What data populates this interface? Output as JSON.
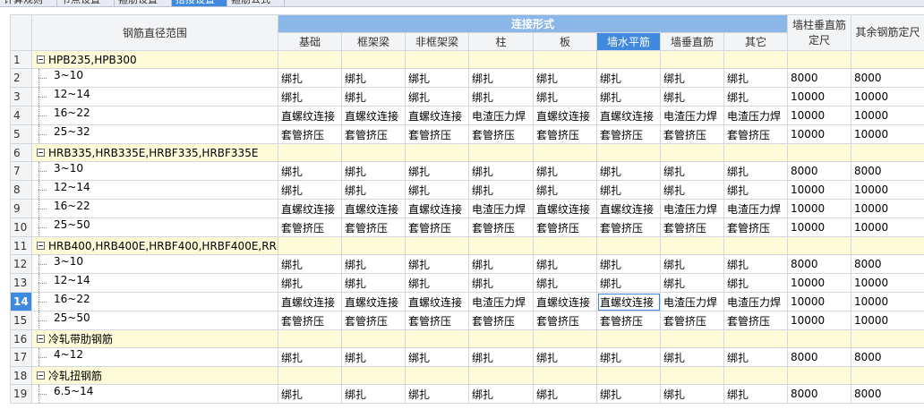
{
  "tabs": [
    {
      "label": "计算规则"
    },
    {
      "label": "节点设置"
    },
    {
      "label": "箍筋设置"
    },
    {
      "label": "搭接设置"
    },
    {
      "label": "箍筋公式"
    }
  ],
  "header": {
    "diameter": "钢筋直径范围",
    "connection_group": "连接形式",
    "columns": [
      "基础",
      "框架梁",
      "非框架梁",
      "柱",
      "板",
      "墙水平筋",
      "墙垂直筋",
      "其它"
    ],
    "wall_col_length": "墙柱垂直筋定尺",
    "other_length": "其余钢筋定尺"
  },
  "rows": [
    {
      "num": "1",
      "group": true,
      "label": "HPB235,HPB300"
    },
    {
      "num": "2",
      "label": "3~10",
      "cells": [
        "绑扎",
        "绑扎",
        "绑扎",
        "绑扎",
        "绑扎",
        "绑扎",
        "绑扎",
        "绑扎",
        "8000",
        "8000"
      ]
    },
    {
      "num": "3",
      "label": "12~14",
      "cells": [
        "绑扎",
        "绑扎",
        "绑扎",
        "绑扎",
        "绑扎",
        "绑扎",
        "绑扎",
        "绑扎",
        "10000",
        "10000"
      ]
    },
    {
      "num": "4",
      "label": "16~22",
      "cells": [
        "直螺纹连接",
        "直螺纹连接",
        "直螺纹连接",
        "电渣压力焊",
        "直螺纹连接",
        "直螺纹连接",
        "电渣压力焊",
        "电渣压力焊",
        "10000",
        "10000"
      ]
    },
    {
      "num": "5",
      "label": "25~32",
      "cells": [
        "套管挤压",
        "套管挤压",
        "套管挤压",
        "套管挤压",
        "套管挤压",
        "套管挤压",
        "套管挤压",
        "套管挤压",
        "10000",
        "10000"
      ]
    },
    {
      "num": "6",
      "group": true,
      "label": "HRB335,HRB335E,HRBF335,HRBF335E"
    },
    {
      "num": "7",
      "label": "3~10",
      "cells": [
        "绑扎",
        "绑扎",
        "绑扎",
        "绑扎",
        "绑扎",
        "绑扎",
        "绑扎",
        "绑扎",
        "8000",
        "8000"
      ]
    },
    {
      "num": "8",
      "label": "12~14",
      "cells": [
        "绑扎",
        "绑扎",
        "绑扎",
        "绑扎",
        "绑扎",
        "绑扎",
        "绑扎",
        "绑扎",
        "10000",
        "10000"
      ]
    },
    {
      "num": "9",
      "label": "16~22",
      "cells": [
        "直螺纹连接",
        "直螺纹连接",
        "直螺纹连接",
        "电渣压力焊",
        "直螺纹连接",
        "直螺纹连接",
        "电渣压力焊",
        "电渣压力焊",
        "10000",
        "10000"
      ]
    },
    {
      "num": "10",
      "label": "25~50",
      "cells": [
        "套管挤压",
        "套管挤压",
        "套管挤压",
        "套管挤压",
        "套管挤压",
        "套管挤压",
        "套管挤压",
        "套管挤压",
        "10000",
        "10000"
      ]
    },
    {
      "num": "11",
      "group": true,
      "label": "HRB400,HRB400E,HRBF400,HRBF400E,RR..."
    },
    {
      "num": "12",
      "label": "3~10",
      "cells": [
        "绑扎",
        "绑扎",
        "绑扎",
        "绑扎",
        "绑扎",
        "绑扎",
        "绑扎",
        "绑扎",
        "8000",
        "8000"
      ]
    },
    {
      "num": "13",
      "label": "12~14",
      "cells": [
        "绑扎",
        "绑扎",
        "绑扎",
        "绑扎",
        "绑扎",
        "绑扎",
        "绑扎",
        "绑扎",
        "10000",
        "10000"
      ]
    },
    {
      "num": "14",
      "label": "16~22",
      "selected": true,
      "cells": [
        "直螺纹连接",
        "直螺纹连接",
        "直螺纹连接",
        "电渣压力焊",
        "直螺纹连接",
        "直螺纹连接",
        "电渣压力焊",
        "电渣压力焊",
        "10000",
        "10000"
      ]
    },
    {
      "num": "15",
      "label": "25~50",
      "cells": [
        "套管挤压",
        "套管挤压",
        "套管挤压",
        "套管挤压",
        "套管挤压",
        "套管挤压",
        "套管挤压",
        "套管挤压",
        "10000",
        "10000"
      ]
    },
    {
      "num": "16",
      "group": true,
      "label": "冷轧带肋钢筋"
    },
    {
      "num": "17",
      "label": "4~12",
      "cells": [
        "绑扎",
        "绑扎",
        "绑扎",
        "绑扎",
        "绑扎",
        "绑扎",
        "绑扎",
        "绑扎",
        "8000",
        "8000"
      ]
    },
    {
      "num": "18",
      "group": true,
      "label": "冷轧扭钢筋"
    },
    {
      "num": "19",
      "label": "6.5~14",
      "cells": [
        "绑扎",
        "绑扎",
        "绑扎",
        "绑扎",
        "绑扎",
        "绑扎",
        "绑扎",
        "绑扎",
        "8000",
        "8000"
      ]
    }
  ],
  "colors": {
    "accent": "#3f89de",
    "group_header": "#8ab6e8",
    "group_row": "#fffbd8",
    "grid_line": "#d3d7de"
  }
}
